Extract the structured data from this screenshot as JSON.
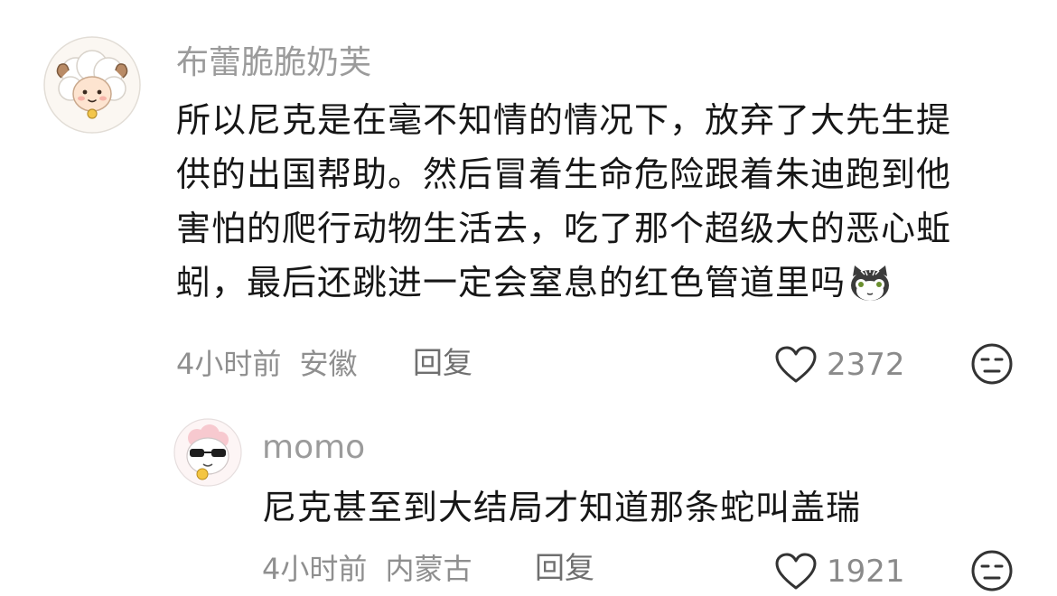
{
  "comments": [
    {
      "username": "布蕾脆脆奶芙",
      "text_lines": [
        "所以尼克是在毫不知情的情况下，放弃了大先生提",
        "供的出国帮助。然后冒着生命危险跟着朱迪跑到他",
        "害怕的爬行动物生活去，吃了那个超级大的恶心蚯",
        "蚓，最后还跳进一定会窒息的红色管道里吗"
      ],
      "emoji": "cat-sticker",
      "time": "4小时前",
      "location": "安徽",
      "reply_label": "回复",
      "like_icon": "heart-outline",
      "likes": "2372",
      "react_icon": "meh-face"
    },
    {
      "username": "momo",
      "text_lines": [
        "尼克甚至到大结局才知道那条蛇叫盖瑞"
      ],
      "time": "4小时前",
      "location": "内蒙古",
      "reply_label": "回复",
      "like_icon": "heart-outline",
      "likes": "1921",
      "react_icon": "meh-face"
    }
  ],
  "colors": {
    "text": "#161616",
    "secondary": "#9b9b9b",
    "icon": "#333333"
  }
}
